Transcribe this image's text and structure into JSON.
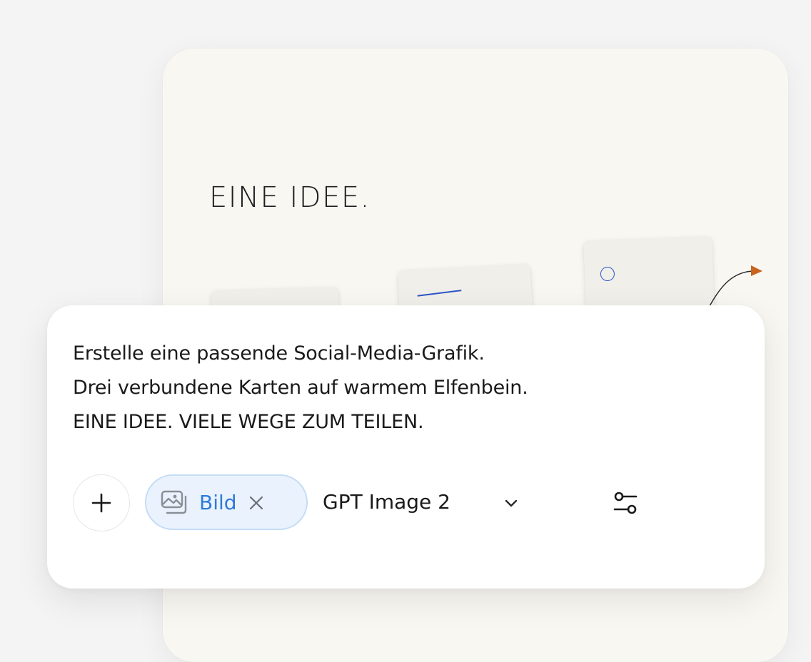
{
  "poster": {
    "title": "EINE IDEE.",
    "accent_blue": "#2d55c8",
    "accent_orange": "#c8641e",
    "background": "#f9f7f2"
  },
  "composer": {
    "prompt_lines": [
      "Erstelle eine passende Social-Media-Grafik.",
      "Drei verbundene Karten auf warmem Elfenbein.",
      "EINE IDEE. VIELE WEGE ZUM TEILEN."
    ],
    "toolbar": {
      "add_icon": "plus-icon",
      "chip": {
        "icon": "image-icon",
        "label": "Bild",
        "remove_icon": "close-icon",
        "accent": "#2f7bd9"
      },
      "model": {
        "selected": "GPT Image 2",
        "dropdown_icon": "chevron-down-icon"
      },
      "settings_icon": "sliders-icon"
    }
  }
}
